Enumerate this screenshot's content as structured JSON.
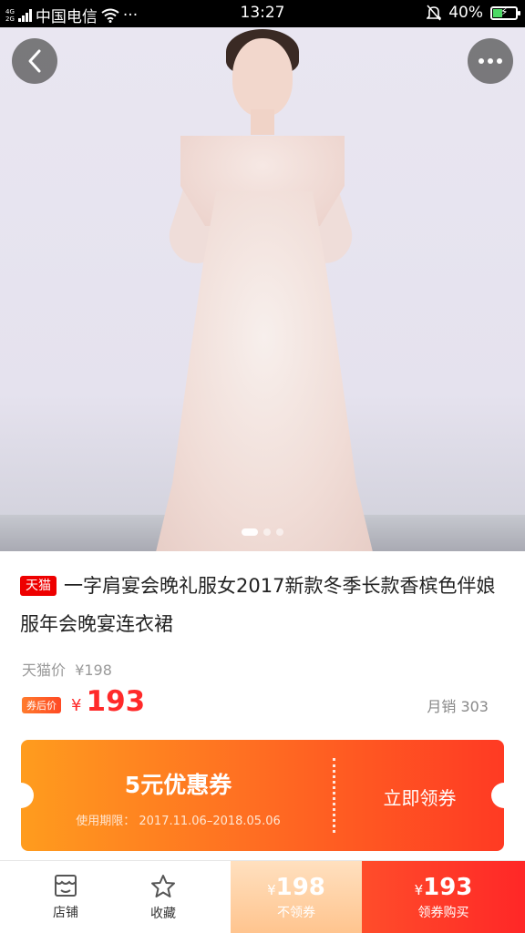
{
  "status_bar": {
    "network_top": "4G",
    "network_bottom": "2G",
    "carrier": "中国电信",
    "more": "···",
    "time": "13:27",
    "battery": "40%",
    "battery_level": 0.4
  },
  "product": {
    "image_index": 1,
    "tag": "天猫",
    "title": "一字肩宴会晚礼服女2017新款冬季长款香槟色伴娘服年会晚宴连衣裙",
    "orig_price_label": "天猫价",
    "orig_price": "¥198",
    "after_coupon_label": "券后价",
    "currency": "¥",
    "final_price": "193",
    "monthly_sales": "月销 303"
  },
  "coupon": {
    "amount": "5元优惠券",
    "validity_label": "使用期限：",
    "validity": "2017.11.06–2018.05.06",
    "claim": "立即领券"
  },
  "bottom_bar": {
    "shop": "店铺",
    "favorite": "收藏",
    "currency": "¥",
    "price_no_coupon": "198",
    "price_no_coupon_label": "不领券",
    "price_with_coupon": "193",
    "price_with_coupon_label": "领券购买"
  },
  "colors": {
    "accent_red": "#ff2a2a",
    "coupon_orange": "#ff9c1e",
    "status_bar_bg": "#000000"
  },
  "icons": [
    "back-icon",
    "more-icon",
    "shop-icon",
    "star-icon",
    "wifi-icon",
    "mute-icon",
    "battery-icon"
  ]
}
